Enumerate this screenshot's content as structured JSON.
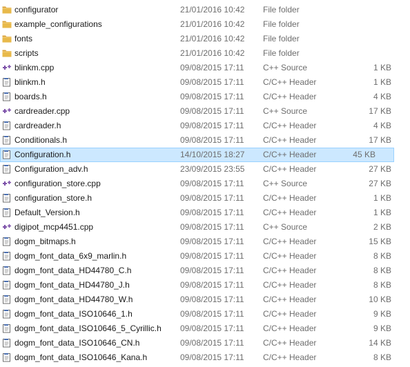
{
  "files": [
    {
      "name": "configurator",
      "date": "21/01/2016 10:42",
      "type": "File folder",
      "size": "",
      "icon": "folder-icon"
    },
    {
      "name": "example_configurations",
      "date": "21/01/2016 10:42",
      "type": "File folder",
      "size": "",
      "icon": "folder-icon"
    },
    {
      "name": "fonts",
      "date": "21/01/2016 10:42",
      "type": "File folder",
      "size": "",
      "icon": "folder-icon"
    },
    {
      "name": "scripts",
      "date": "21/01/2016 10:42",
      "type": "File folder",
      "size": "",
      "icon": "folder-icon"
    },
    {
      "name": "blinkm.cpp",
      "date": "09/08/2015 17:11",
      "type": "C++ Source",
      "size": "1 KB",
      "icon": "cpp-source-icon"
    },
    {
      "name": "blinkm.h",
      "date": "09/08/2015 17:11",
      "type": "C/C++ Header",
      "size": "1 KB",
      "icon": "header-file-icon"
    },
    {
      "name": "boards.h",
      "date": "09/08/2015 17:11",
      "type": "C/C++ Header",
      "size": "4 KB",
      "icon": "header-file-icon"
    },
    {
      "name": "cardreader.cpp",
      "date": "09/08/2015 17:11",
      "type": "C++ Source",
      "size": "17 KB",
      "icon": "cpp-source-icon"
    },
    {
      "name": "cardreader.h",
      "date": "09/08/2015 17:11",
      "type": "C/C++ Header",
      "size": "4 KB",
      "icon": "header-file-icon"
    },
    {
      "name": "Conditionals.h",
      "date": "09/08/2015 17:11",
      "type": "C/C++ Header",
      "size": "17 KB",
      "icon": "header-file-icon"
    },
    {
      "name": "Configuration.h",
      "date": "14/10/2015 18:27",
      "type": "C/C++ Header",
      "size": "45 KB",
      "icon": "header-file-icon",
      "selected": true
    },
    {
      "name": "Configuration_adv.h",
      "date": "23/09/2015 23:55",
      "type": "C/C++ Header",
      "size": "27 KB",
      "icon": "header-file-icon"
    },
    {
      "name": "configuration_store.cpp",
      "date": "09/08/2015 17:11",
      "type": "C++ Source",
      "size": "27 KB",
      "icon": "cpp-source-icon"
    },
    {
      "name": "configuration_store.h",
      "date": "09/08/2015 17:11",
      "type": "C/C++ Header",
      "size": "1 KB",
      "icon": "header-file-icon"
    },
    {
      "name": "Default_Version.h",
      "date": "09/08/2015 17:11",
      "type": "C/C++ Header",
      "size": "1 KB",
      "icon": "header-file-icon"
    },
    {
      "name": "digipot_mcp4451.cpp",
      "date": "09/08/2015 17:11",
      "type": "C++ Source",
      "size": "2 KB",
      "icon": "cpp-source-icon"
    },
    {
      "name": "dogm_bitmaps.h",
      "date": "09/08/2015 17:11",
      "type": "C/C++ Header",
      "size": "15 KB",
      "icon": "header-file-icon"
    },
    {
      "name": "dogm_font_data_6x9_marlin.h",
      "date": "09/08/2015 17:11",
      "type": "C/C++ Header",
      "size": "8 KB",
      "icon": "header-file-icon"
    },
    {
      "name": "dogm_font_data_HD44780_C.h",
      "date": "09/08/2015 17:11",
      "type": "C/C++ Header",
      "size": "8 KB",
      "icon": "header-file-icon"
    },
    {
      "name": "dogm_font_data_HD44780_J.h",
      "date": "09/08/2015 17:11",
      "type": "C/C++ Header",
      "size": "8 KB",
      "icon": "header-file-icon"
    },
    {
      "name": "dogm_font_data_HD44780_W.h",
      "date": "09/08/2015 17:11",
      "type": "C/C++ Header",
      "size": "10 KB",
      "icon": "header-file-icon"
    },
    {
      "name": "dogm_font_data_ISO10646_1.h",
      "date": "09/08/2015 17:11",
      "type": "C/C++ Header",
      "size": "9 KB",
      "icon": "header-file-icon"
    },
    {
      "name": "dogm_font_data_ISO10646_5_Cyrillic.h",
      "date": "09/08/2015 17:11",
      "type": "C/C++ Header",
      "size": "9 KB",
      "icon": "header-file-icon"
    },
    {
      "name": "dogm_font_data_ISO10646_CN.h",
      "date": "09/08/2015 17:11",
      "type": "C/C++ Header",
      "size": "14 KB",
      "icon": "header-file-icon"
    },
    {
      "name": "dogm_font_data_ISO10646_Kana.h",
      "date": "09/08/2015 17:11",
      "type": "C/C++ Header",
      "size": "8 KB",
      "icon": "header-file-icon"
    }
  ],
  "colors": {
    "selection_background": "#cce8ff",
    "selection_border": "#99d1ff",
    "folder": "#e8b94a",
    "cpp_plus": "#7b4fa8"
  }
}
